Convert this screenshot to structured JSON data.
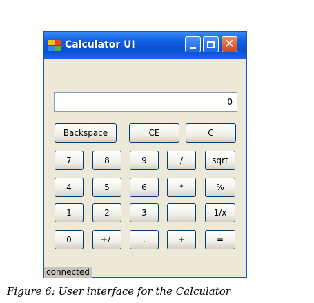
{
  "window": {
    "title": "Calculator UI",
    "controls": {
      "minimize": "minimize",
      "maximize": "maximize",
      "close": "close"
    }
  },
  "display": {
    "value": "0"
  },
  "buttons": {
    "backspace": "Backspace",
    "ce": "CE",
    "c": "C",
    "seven": "7",
    "eight": "8",
    "nine": "9",
    "divide": "/",
    "sqrt": "sqrt",
    "four": "4",
    "five": "5",
    "six": "6",
    "multiply": "*",
    "percent": "%",
    "one": "1",
    "two": "2",
    "three": "3",
    "minus": "-",
    "reciprocal": "1/x",
    "zero": "0",
    "plusminus": "+/-",
    "decimal": ".",
    "plus": "+",
    "equals": "="
  },
  "status": {
    "text": "connected"
  },
  "caption": "Figure 6: User interface for the Calculator",
  "colors": {
    "titlebar": "#0f5fe0",
    "window_bg": "#ece9d8",
    "button_border": "#003c74",
    "close_button": "#d5431c"
  },
  "icons": [
    "app-icon",
    "minimize-icon",
    "maximize-icon",
    "close-icon"
  ]
}
